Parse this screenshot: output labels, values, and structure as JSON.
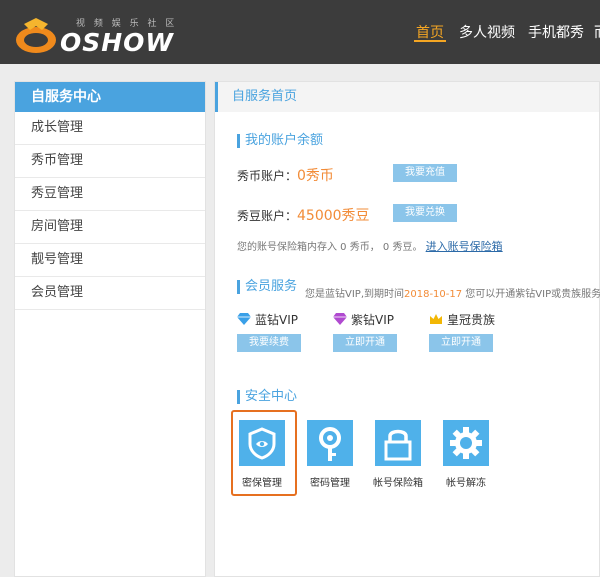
{
  "header": {
    "logo_tagline": "视 频 娱 乐 社 区",
    "logo_text": "OSHOW",
    "nav": [
      {
        "label": "首页",
        "active": true
      },
      {
        "label": "多人视频",
        "active": false
      },
      {
        "label": "手机都秀",
        "active": false
      },
      {
        "label": "而",
        "active": false
      }
    ],
    "accent_color": "#f5a623"
  },
  "sidebar": {
    "title": "自服务中心",
    "items": [
      "成长管理",
      "秀币管理",
      "秀豆管理",
      "房间管理",
      "靓号管理",
      "会员管理"
    ]
  },
  "main": {
    "breadcrumb": "自服务首页",
    "balance": {
      "title": "我的账户余额",
      "coin_label": "秀币账户：",
      "coin_value": "0秀币",
      "coin_button": "我要充值",
      "bean_label": "秀豆账户：",
      "bean_value": "45000秀豆",
      "bean_button": "我要兑换",
      "note": "您的账号保险箱内存入 0 秀币， 0 秀豆。",
      "note_link": "进入账号保险箱"
    },
    "vip": {
      "title": "会员服务",
      "desc_prefix": "您是蓝钻VIP,到期时间",
      "desc_date": "2018-10-17",
      "desc_suffix": " 您可以开通紫钻VIP或贵族服务",
      "items": [
        {
          "name": "蓝钻VIP",
          "button": "我要续费",
          "icon": "blue-diamond-icon",
          "color": "#3aa0e8"
        },
        {
          "name": "紫钻VIP",
          "button": "立即开通",
          "icon": "purple-diamond-icon",
          "color": "#b04ad0"
        },
        {
          "name": "皇冠贵族",
          "button": "立即开通",
          "icon": "crown-icon",
          "color": "#f2b705"
        }
      ]
    },
    "security": {
      "title": "安全中心",
      "items": [
        {
          "label": "密保管理",
          "icon": "shield-icon",
          "selected": true
        },
        {
          "label": "密码管理",
          "icon": "key-icon",
          "selected": false
        },
        {
          "label": "帐号保险箱",
          "icon": "lock-icon",
          "selected": false
        },
        {
          "label": "帐号解冻",
          "icon": "gear-icon",
          "selected": false
        }
      ]
    }
  }
}
